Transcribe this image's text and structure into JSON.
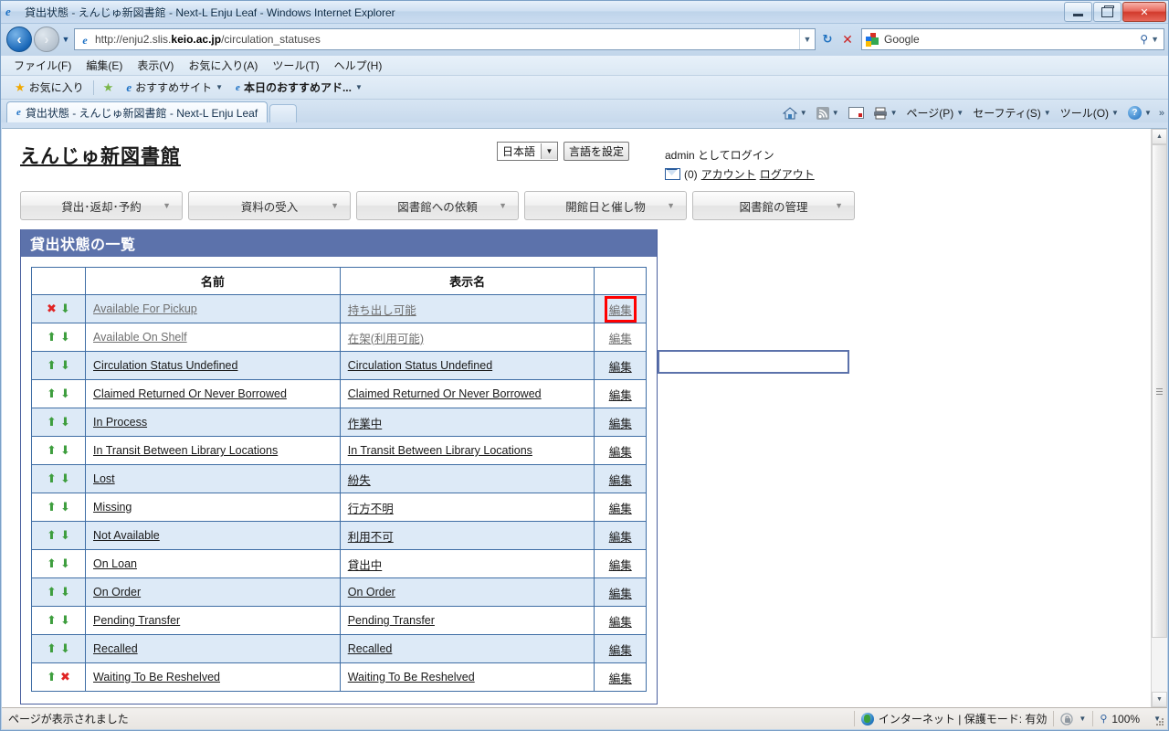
{
  "window": {
    "title": "貸出状態 - えんじゅ新図書館 - Next-L Enju Leaf - Windows Internet Explorer",
    "minimize_label": "",
    "maximize_label": "",
    "close_label": "✕"
  },
  "nav": {
    "back_glyph": "◄",
    "forward_glyph": "►",
    "url_prefix": "http://enju2.slis.",
    "url_bold": "keio.ac.jp",
    "url_suffix": "/circulation_statuses",
    "url_full": "http://enju2.slis.keio.ac.jp/circulation_statuses",
    "refresh_glyph": "↻",
    "stop_glyph": "✕",
    "search_provider": "Google",
    "search_placeholder": "Google"
  },
  "menubar": {
    "items": [
      "ファイル(F)",
      "編集(E)",
      "表示(V)",
      "お気に入り(A)",
      "ツール(T)",
      "ヘルプ(H)"
    ]
  },
  "favbar": {
    "favorites_label": "お気に入り",
    "items": [
      "おすすめサイト",
      "本日のおすすめアド..."
    ]
  },
  "tabbar": {
    "tab_label": "貸出状態 - えんじゅ新図書館 - Next-L Enju Leaf",
    "new_tab_label": ""
  },
  "commandbar": {
    "items": [
      {
        "name": "home",
        "label": ""
      },
      {
        "name": "feeds",
        "label": ""
      },
      {
        "name": "read-mail",
        "label": ""
      },
      {
        "name": "print",
        "label": ""
      },
      {
        "name": "page",
        "label": "ページ(P)"
      },
      {
        "name": "safety",
        "label": "セーフティ(S)"
      },
      {
        "name": "tools",
        "label": "ツール(O)"
      },
      {
        "name": "help",
        "label": ""
      }
    ],
    "overflow_glyph": "»"
  },
  "page": {
    "site_title": "えんじゅ新図書館",
    "language": {
      "selected": "日本語",
      "set_button": "言語を設定"
    },
    "account": {
      "login_text": "admin としてログイン",
      "message_count": "(0)",
      "account_link": "アカウント",
      "logout_link": "ログアウト"
    },
    "nav_menu": [
      "貸出･返却･予約",
      "資料の受入",
      "図書館への依頼",
      "開館日と催し物",
      "図書館の管理"
    ],
    "panel_title": "貸出状態の一覧",
    "side_input_value": "",
    "table": {
      "columns": [
        "",
        "名前",
        "表示名",
        ""
      ],
      "edit_label": "編集",
      "rows": [
        {
          "up": "x",
          "down": "down",
          "name": "Available For Pickup",
          "display": "持ち出し可能",
          "edit": "編集",
          "dim": true,
          "highlight": true
        },
        {
          "up": "up",
          "down": "down",
          "name": "Available On Shelf",
          "display": "在架(利用可能)",
          "edit": "編集",
          "dim": true,
          "highlight": false
        },
        {
          "up": "up",
          "down": "down",
          "name": "Circulation Status Undefined",
          "display": "Circulation Status Undefined",
          "edit": "編集",
          "dim": false,
          "highlight": false
        },
        {
          "up": "up",
          "down": "down",
          "name": "Claimed Returned Or Never Borrowed",
          "display": "Claimed Returned Or Never Borrowed",
          "edit": "編集",
          "dim": false,
          "highlight": false
        },
        {
          "up": "up",
          "down": "down",
          "name": "In Process",
          "display": "作業中",
          "edit": "編集",
          "dim": false,
          "highlight": false
        },
        {
          "up": "up",
          "down": "down",
          "name": "In Transit Between Library Locations",
          "display": "In Transit Between Library Locations",
          "edit": "編集",
          "dim": false,
          "highlight": false
        },
        {
          "up": "up",
          "down": "down",
          "name": "Lost",
          "display": "紛失",
          "edit": "編集",
          "dim": false,
          "highlight": false
        },
        {
          "up": "up",
          "down": "down",
          "name": "Missing",
          "display": "行方不明",
          "edit": "編集",
          "dim": false,
          "highlight": false
        },
        {
          "up": "up",
          "down": "down",
          "name": "Not Available",
          "display": "利用不可",
          "edit": "編集",
          "dim": false,
          "highlight": false
        },
        {
          "up": "up",
          "down": "down",
          "name": "On Loan",
          "display": "貸出中",
          "edit": "編集",
          "dim": false,
          "highlight": false
        },
        {
          "up": "up",
          "down": "down",
          "name": "On Order",
          "display": "On Order",
          "edit": "編集",
          "dim": false,
          "highlight": false
        },
        {
          "up": "up",
          "down": "down",
          "name": "Pending Transfer",
          "display": "Pending Transfer",
          "edit": "編集",
          "dim": false,
          "highlight": false
        },
        {
          "up": "up",
          "down": "down",
          "name": "Recalled",
          "display": "Recalled",
          "edit": "編集",
          "dim": false,
          "highlight": false
        },
        {
          "up": "up",
          "down": "x",
          "name": "Waiting To Be Reshelved",
          "display": "Waiting To Be Reshelved",
          "edit": "編集",
          "dim": false,
          "highlight": false
        }
      ]
    }
  },
  "statusbar": {
    "message": "ページが表示されました",
    "zone": "インターネット | 保護モード: 有効",
    "zoom": "100%"
  },
  "colors": {
    "panel_header": "#5c72ab",
    "row_odd": "#ddeaf7",
    "table_border": "#3f6ea5",
    "highlight": "#ff0000",
    "arrow_green": "#3e9e3e",
    "arrow_red": "#e02424"
  }
}
